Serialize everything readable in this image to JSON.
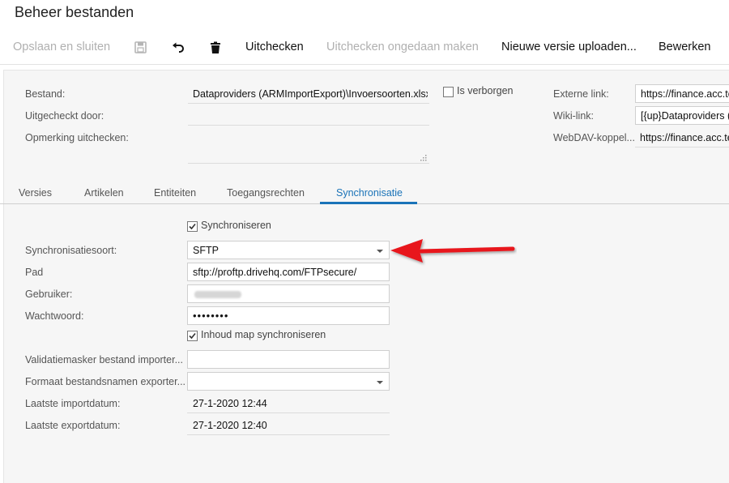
{
  "window": {
    "title": "Beheer bestanden"
  },
  "toolbar": {
    "save_close": "Opslaan en sluiten",
    "save_icon": "save-icon",
    "undo_icon": "undo-icon",
    "delete_icon": "trash-icon",
    "checkout": "Uitchecken",
    "undo_checkout": "Uitchecken ongedaan maken",
    "upload_new_version": "Nieuwe versie uploaden...",
    "edit": "Bewerken"
  },
  "details": {
    "file_label": "Bestand:",
    "file_value": "Dataproviders (ARMImportExport)\\Invoersoorten.xlsx",
    "checked_out_by_label": "Uitgecheckt door:",
    "checked_out_by_value": "",
    "checkout_comment_label": "Opmerking uitchecken:",
    "checkout_comment_value": "",
    "hidden_label": "Is verborgen",
    "hidden_checked": false,
    "external_link_label": "Externe link:",
    "external_link_value": "https://finance.acc.te",
    "wiki_link_label": "Wiki-link:",
    "wiki_link_value": "[{up}Dataproviders (A",
    "webdav_label": "WebDAV-koppel...",
    "webdav_value": "https://finance.acc.te"
  },
  "tabs": [
    {
      "label": "Versies"
    },
    {
      "label": "Artikelen"
    },
    {
      "label": "Entiteiten"
    },
    {
      "label": "Toegangsrechten"
    },
    {
      "label": "Synchronisatie"
    }
  ],
  "active_tab": "Synchronisatie",
  "sync": {
    "synchronize_label": "Synchroniseren",
    "synchronize_checked": true,
    "type_label": "Synchronisatiesoort:",
    "type_value": "SFTP",
    "path_label": "Pad",
    "path_value": "sftp://proftp.drivehq.com/FTPsecure/",
    "user_label": "Gebruiker:",
    "user_value": "",
    "password_label": "Wachtwoord:",
    "password_value": "••••••••",
    "sync_folder_label": "Inhoud map synchroniseren",
    "sync_folder_checked": true,
    "validation_mask_label": "Validatiemasker bestand importer...",
    "validation_mask_value": "",
    "export_format_label": "Formaat bestandsnamen exporter...",
    "export_format_value": "",
    "last_import_label": "Laatste importdatum:",
    "last_import_value": "27-1-2020 12:44",
    "last_export_label": "Laatste exportdatum:",
    "last_export_value": "27-1-2020 12:40"
  },
  "colors": {
    "accent": "#1a73b8",
    "annotation_arrow": "#e8141b"
  }
}
